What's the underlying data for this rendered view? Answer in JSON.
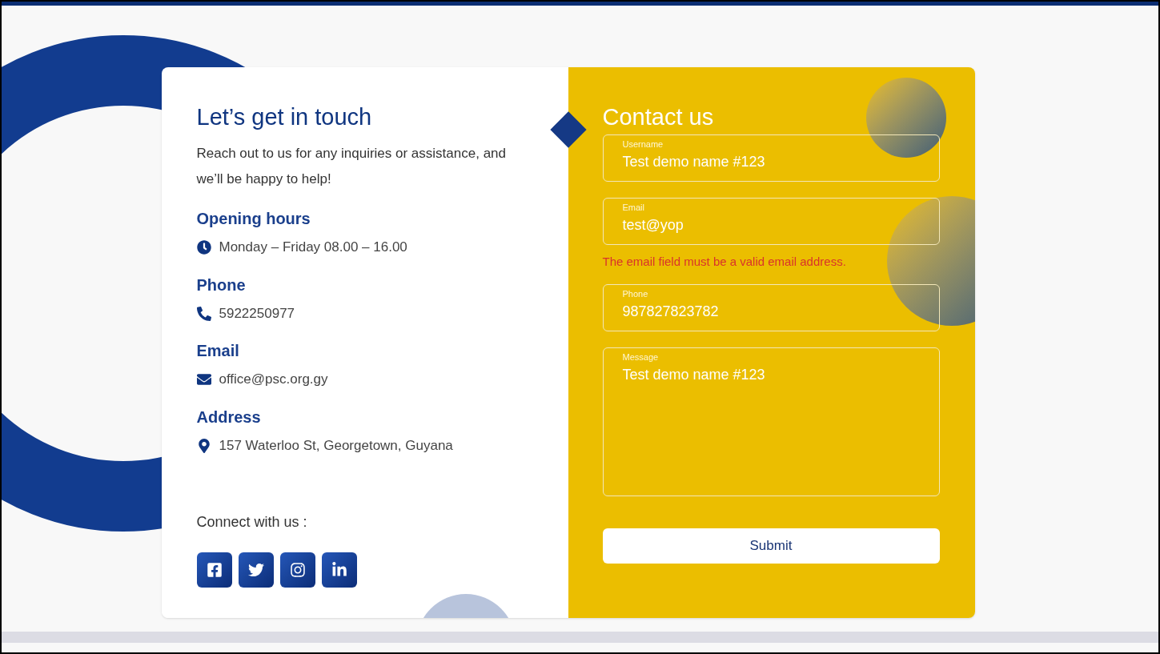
{
  "info": {
    "title": "Let’s get in touch",
    "intro": "Reach out to us for any inquiries or assistance, and we’ll be happy to help!",
    "sections": [
      {
        "kind": "clock",
        "heading": "Opening hours",
        "text": "Monday – Friday 08.00 – 16.00"
      },
      {
        "kind": "phone",
        "heading": "Phone",
        "text": "5922250977"
      },
      {
        "kind": "email",
        "heading": "Email",
        "text": "office@psc.org.gy"
      },
      {
        "kind": "pin",
        "heading": "Address",
        "text": "157 Waterloo St, Georgetown, Guyana"
      }
    ],
    "connect": "Connect with us :",
    "social": [
      {
        "kind": "facebook"
      },
      {
        "kind": "twitter"
      },
      {
        "kind": "instagram"
      },
      {
        "kind": "linkedin"
      }
    ]
  },
  "form": {
    "title": "Contact us",
    "fields": [
      {
        "kind": "input",
        "label": "Username",
        "value": "Test demo name #123"
      },
      {
        "kind": "input",
        "label": "Email",
        "value": "test@yop",
        "error": "The email field must be a valid email address."
      },
      {
        "kind": "input",
        "label": "Phone",
        "value": "987827823782"
      },
      {
        "kind": "textarea",
        "label": "Message",
        "value": "Test demo name #123"
      }
    ],
    "submit": "Submit"
  }
}
